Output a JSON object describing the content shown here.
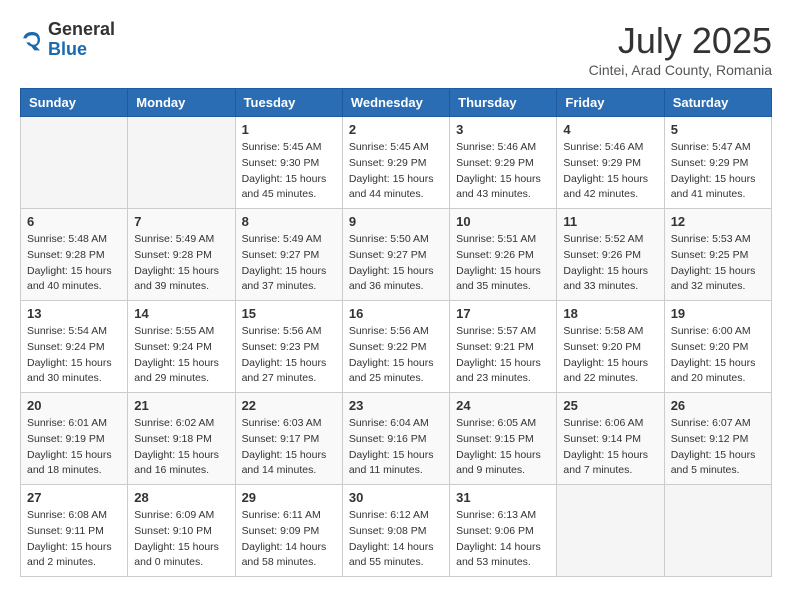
{
  "logo": {
    "general": "General",
    "blue": "Blue"
  },
  "header": {
    "month_year": "July 2025",
    "location": "Cintei, Arad County, Romania"
  },
  "weekdays": [
    "Sunday",
    "Monday",
    "Tuesday",
    "Wednesday",
    "Thursday",
    "Friday",
    "Saturday"
  ],
  "weeks": [
    [
      {
        "day": "",
        "info": ""
      },
      {
        "day": "",
        "info": ""
      },
      {
        "day": "1",
        "info": "Sunrise: 5:45 AM\nSunset: 9:30 PM\nDaylight: 15 hours and 45 minutes."
      },
      {
        "day": "2",
        "info": "Sunrise: 5:45 AM\nSunset: 9:29 PM\nDaylight: 15 hours and 44 minutes."
      },
      {
        "day": "3",
        "info": "Sunrise: 5:46 AM\nSunset: 9:29 PM\nDaylight: 15 hours and 43 minutes."
      },
      {
        "day": "4",
        "info": "Sunrise: 5:46 AM\nSunset: 9:29 PM\nDaylight: 15 hours and 42 minutes."
      },
      {
        "day": "5",
        "info": "Sunrise: 5:47 AM\nSunset: 9:29 PM\nDaylight: 15 hours and 41 minutes."
      }
    ],
    [
      {
        "day": "6",
        "info": "Sunrise: 5:48 AM\nSunset: 9:28 PM\nDaylight: 15 hours and 40 minutes."
      },
      {
        "day": "7",
        "info": "Sunrise: 5:49 AM\nSunset: 9:28 PM\nDaylight: 15 hours and 39 minutes."
      },
      {
        "day": "8",
        "info": "Sunrise: 5:49 AM\nSunset: 9:27 PM\nDaylight: 15 hours and 37 minutes."
      },
      {
        "day": "9",
        "info": "Sunrise: 5:50 AM\nSunset: 9:27 PM\nDaylight: 15 hours and 36 minutes."
      },
      {
        "day": "10",
        "info": "Sunrise: 5:51 AM\nSunset: 9:26 PM\nDaylight: 15 hours and 35 minutes."
      },
      {
        "day": "11",
        "info": "Sunrise: 5:52 AM\nSunset: 9:26 PM\nDaylight: 15 hours and 33 minutes."
      },
      {
        "day": "12",
        "info": "Sunrise: 5:53 AM\nSunset: 9:25 PM\nDaylight: 15 hours and 32 minutes."
      }
    ],
    [
      {
        "day": "13",
        "info": "Sunrise: 5:54 AM\nSunset: 9:24 PM\nDaylight: 15 hours and 30 minutes."
      },
      {
        "day": "14",
        "info": "Sunrise: 5:55 AM\nSunset: 9:24 PM\nDaylight: 15 hours and 29 minutes."
      },
      {
        "day": "15",
        "info": "Sunrise: 5:56 AM\nSunset: 9:23 PM\nDaylight: 15 hours and 27 minutes."
      },
      {
        "day": "16",
        "info": "Sunrise: 5:56 AM\nSunset: 9:22 PM\nDaylight: 15 hours and 25 minutes."
      },
      {
        "day": "17",
        "info": "Sunrise: 5:57 AM\nSunset: 9:21 PM\nDaylight: 15 hours and 23 minutes."
      },
      {
        "day": "18",
        "info": "Sunrise: 5:58 AM\nSunset: 9:20 PM\nDaylight: 15 hours and 22 minutes."
      },
      {
        "day": "19",
        "info": "Sunrise: 6:00 AM\nSunset: 9:20 PM\nDaylight: 15 hours and 20 minutes."
      }
    ],
    [
      {
        "day": "20",
        "info": "Sunrise: 6:01 AM\nSunset: 9:19 PM\nDaylight: 15 hours and 18 minutes."
      },
      {
        "day": "21",
        "info": "Sunrise: 6:02 AM\nSunset: 9:18 PM\nDaylight: 15 hours and 16 minutes."
      },
      {
        "day": "22",
        "info": "Sunrise: 6:03 AM\nSunset: 9:17 PM\nDaylight: 15 hours and 14 minutes."
      },
      {
        "day": "23",
        "info": "Sunrise: 6:04 AM\nSunset: 9:16 PM\nDaylight: 15 hours and 11 minutes."
      },
      {
        "day": "24",
        "info": "Sunrise: 6:05 AM\nSunset: 9:15 PM\nDaylight: 15 hours and 9 minutes."
      },
      {
        "day": "25",
        "info": "Sunrise: 6:06 AM\nSunset: 9:14 PM\nDaylight: 15 hours and 7 minutes."
      },
      {
        "day": "26",
        "info": "Sunrise: 6:07 AM\nSunset: 9:12 PM\nDaylight: 15 hours and 5 minutes."
      }
    ],
    [
      {
        "day": "27",
        "info": "Sunrise: 6:08 AM\nSunset: 9:11 PM\nDaylight: 15 hours and 2 minutes."
      },
      {
        "day": "28",
        "info": "Sunrise: 6:09 AM\nSunset: 9:10 PM\nDaylight: 15 hours and 0 minutes."
      },
      {
        "day": "29",
        "info": "Sunrise: 6:11 AM\nSunset: 9:09 PM\nDaylight: 14 hours and 58 minutes."
      },
      {
        "day": "30",
        "info": "Sunrise: 6:12 AM\nSunset: 9:08 PM\nDaylight: 14 hours and 55 minutes."
      },
      {
        "day": "31",
        "info": "Sunrise: 6:13 AM\nSunset: 9:06 PM\nDaylight: 14 hours and 53 minutes."
      },
      {
        "day": "",
        "info": ""
      },
      {
        "day": "",
        "info": ""
      }
    ]
  ]
}
